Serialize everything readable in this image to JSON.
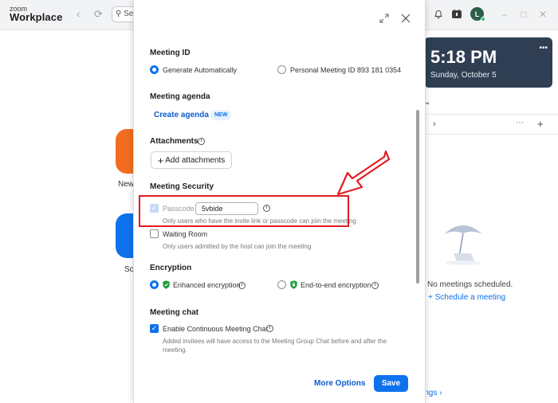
{
  "app": {
    "brand_small": "zoom",
    "brand_big": "Workplace",
    "search_partial": "Se"
  },
  "avatar": {
    "initial": "L",
    "color": "#2a5f4a"
  },
  "background": {
    "new_label": "New",
    "schedule_label": "Sch",
    "clock_time": "5:18 PM",
    "clock_date": "Sunday, October 5",
    "no_meetings": "No meetings scheduled.",
    "schedule_link": "Schedule a meeting",
    "settings_link": "ings"
  },
  "modal": {
    "meeting_id": {
      "title": "Meeting ID",
      "option_auto": "Generate Automatically",
      "option_personal": "Personal Meeting ID 893 181 0354"
    },
    "agenda": {
      "title": "Meeting agenda",
      "create_link": "Create agenda",
      "new_badge": "NEW"
    },
    "attachments": {
      "title": "Attachments",
      "add_button": "Add attachments"
    },
    "security": {
      "title": "Meeting Security",
      "passcode_label": "Passcode",
      "passcode_value": "5vbide",
      "passcode_hint": "Only users who have the invite link or passcode can join the meeting",
      "waiting_room_label": "Waiting Room",
      "waiting_room_hint": "Only users admitted by the host can join the meeting"
    },
    "encryption": {
      "title": "Encryption",
      "enhanced": "Enhanced encryption",
      "e2e": "End-to-end encryption"
    },
    "chat": {
      "title": "Meeting chat",
      "continuous_label": "Enable Continuous Meeting Chat",
      "hint_line1": "Added invitees will have access to the Meeting Group Chat before and after the",
      "hint_line2": "meeting."
    },
    "footer": {
      "more_options": "More Options",
      "save": "Save"
    }
  },
  "colors": {
    "accent": "#0e72ed",
    "annotation": "#e31b23",
    "shield": "#1e9e3e"
  }
}
